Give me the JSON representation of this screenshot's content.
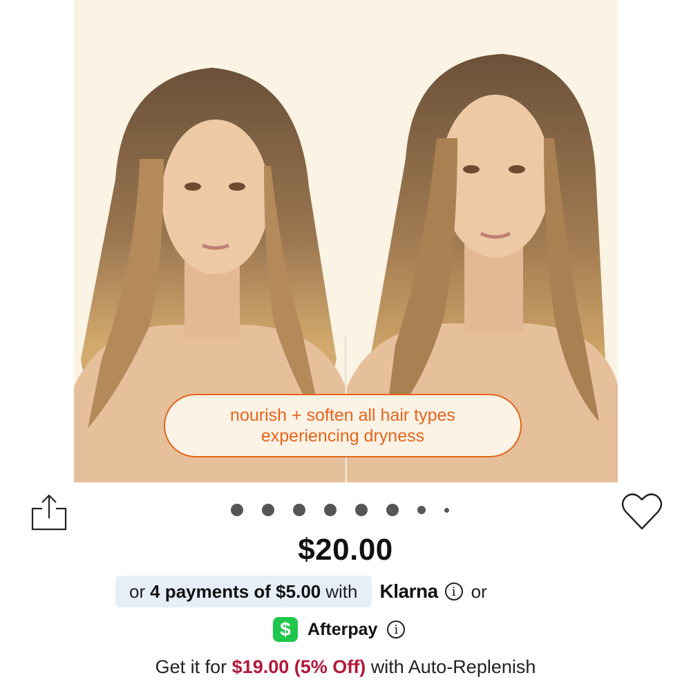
{
  "overlay": {
    "line1": "nourish + soften all hair types",
    "line2": "experiencing dryness"
  },
  "carousel": {
    "total_dots": 8,
    "active_index": 0
  },
  "price": "$20.00",
  "payments": {
    "prefix": "or",
    "installments": "4 payments of $5.00",
    "with": "with",
    "provider1": "Klarna",
    "or": "or",
    "provider2": "Afterpay",
    "cash_icon": "$"
  },
  "replenish": {
    "prefix": "Get it for",
    "price": "$19.00 (5% Off)",
    "suffix": "with Auto-Replenish"
  },
  "colors": {
    "accent_orange": "#e4651a",
    "discount_red": "#b3183a",
    "cash_green": "#1ec74b",
    "klarna_box": "#e6eef8"
  },
  "icons": [
    "share-icon",
    "heart-icon",
    "info-icon",
    "cash-app-icon"
  ]
}
